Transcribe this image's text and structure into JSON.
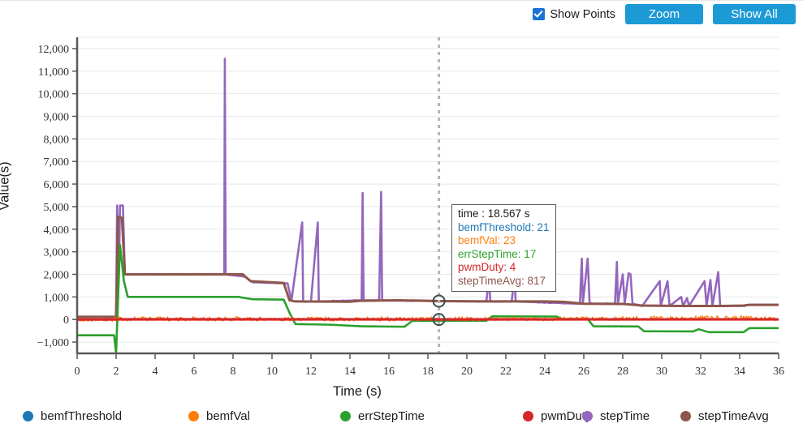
{
  "toolbar": {
    "show_points_label": "Show Points",
    "show_points_checked": true,
    "zoom_label": "Zoom",
    "show_all_label": "Show All",
    "button_color": "#1b9ad6",
    "checkbox_color": "#1a73d4"
  },
  "tooltip": {
    "time": "time : 18.567 s",
    "rows": [
      {
        "text": "bemfThreshold: 21",
        "color": "#1f77b4"
      },
      {
        "text": "bemfVal: 23",
        "color": "#ff7f0e"
      },
      {
        "text": "errStepTime: 17",
        "color": "#2ca02c"
      },
      {
        "text": "pwmDuty: 4",
        "color": "#d62728"
      },
      {
        "text": "stepTimeAvg: 817",
        "color": "#8c564b"
      }
    ]
  },
  "legend": {
    "items": [
      {
        "label": "bemfThreshold",
        "color": "#1f77b4"
      },
      {
        "label": "bemfVal",
        "color": "#ff7f0e"
      },
      {
        "label": "errStepTime",
        "color": "#2ca02c"
      },
      {
        "label": "pwmDuty",
        "color": "#d62728"
      },
      {
        "label": "stepTime",
        "color": "#9467bd"
      },
      {
        "label": "stepTimeAvg",
        "color": "#8c564b"
      }
    ]
  },
  "chart_data": {
    "type": "line",
    "title": "",
    "xlabel": "Time (s)",
    "ylabel": "Value(s)",
    "xlim": [
      0,
      36
    ],
    "ylim": [
      -1500,
      12500
    ],
    "xticks": [
      0,
      2,
      4,
      6,
      8,
      10,
      12,
      14,
      16,
      18,
      20,
      22,
      24,
      26,
      28,
      30,
      32,
      34,
      36
    ],
    "ytick_values": [
      -1000,
      0,
      1000,
      2000,
      3000,
      4000,
      5000,
      6000,
      7000,
      8000,
      9000,
      10000,
      11000,
      12000
    ],
    "ytick_labels": [
      "−1,000",
      "0",
      "1,000",
      "2,000",
      "3,000",
      "4,000",
      "5,000",
      "6,000",
      "7,000",
      "8,000",
      "9,000",
      "10,000",
      "11,000",
      "12,000"
    ],
    "grid": true,
    "legend_position": "bottom",
    "cursor": {
      "x": 18.567,
      "label": "18.567 s",
      "values": {
        "bemfThreshold": 21,
        "bemfVal": 23,
        "errStepTime": 17,
        "pwmDuty": 4,
        "stepTimeAvg": 817
      }
    },
    "series": [
      {
        "name": "bemfThreshold",
        "color": "#1f77b4",
        "points": [
          [
            0,
            21
          ],
          [
            36,
            21
          ]
        ],
        "note": "flat near 21, hidden under pwmDuty/bemfVal traces"
      },
      {
        "name": "bemfVal",
        "color": "#ff7f0e",
        "points": [
          [
            0,
            0
          ],
          [
            2.0,
            0
          ],
          [
            2.1,
            30
          ],
          [
            8.0,
            28
          ],
          [
            10.5,
            25
          ],
          [
            16.0,
            24
          ],
          [
            18.567,
            23
          ],
          [
            24.0,
            30
          ],
          [
            28.0,
            45
          ],
          [
            31.0,
            60
          ],
          [
            33.0,
            75
          ],
          [
            34.5,
            60
          ],
          [
            36,
            40
          ]
        ],
        "note": "noisy band just above zero, amplitude ~±60"
      },
      {
        "name": "errStepTime",
        "color": "#2ca02c",
        "points": [
          [
            0,
            -700
          ],
          [
            1.9,
            -700
          ],
          [
            2.0,
            -1500
          ],
          [
            2.2,
            3300
          ],
          [
            2.4,
            1700
          ],
          [
            2.6,
            1000
          ],
          [
            8.3,
            1000
          ],
          [
            8.6,
            950
          ],
          [
            9.0,
            900
          ],
          [
            10.6,
            880
          ],
          [
            10.9,
            300
          ],
          [
            11.2,
            -200
          ],
          [
            13.0,
            -230
          ],
          [
            14.6,
            -300
          ],
          [
            16.8,
            -320
          ],
          [
            17.2,
            -60
          ],
          [
            21.0,
            -55
          ],
          [
            21.3,
            140
          ],
          [
            24.6,
            130
          ],
          [
            24.9,
            30
          ],
          [
            26.2,
            20
          ],
          [
            26.5,
            -300
          ],
          [
            28.8,
            -310
          ],
          [
            29.1,
            -520
          ],
          [
            31.6,
            -530
          ],
          [
            31.9,
            -430
          ],
          [
            32.4,
            -560
          ],
          [
            34.2,
            -560
          ],
          [
            34.5,
            -380
          ],
          [
            36,
            -380
          ]
        ],
        "note": "green step trace with plateaus"
      },
      {
        "name": "pwmDuty",
        "color": "#d62728",
        "points": [
          [
            0,
            0
          ],
          [
            2.0,
            0
          ],
          [
            2.2,
            10
          ],
          [
            10.0,
            8
          ],
          [
            18.567,
            4
          ],
          [
            26.0,
            5
          ],
          [
            32.0,
            6
          ],
          [
            36,
            5
          ]
        ],
        "note": "essentially flat red line at ~0-10"
      },
      {
        "name": "stepTime",
        "color": "#9467bd",
        "points": [
          [
            0,
            0
          ],
          [
            2.0,
            0
          ],
          [
            2.05,
            5050
          ],
          [
            2.15,
            2300
          ],
          [
            2.2,
            5050
          ],
          [
            2.35,
            5050
          ],
          [
            2.45,
            2000
          ],
          [
            7.55,
            2000
          ],
          [
            7.58,
            11550
          ],
          [
            7.62,
            2000
          ],
          [
            8.6,
            1900
          ],
          [
            9.0,
            1650
          ],
          [
            10.8,
            1600
          ],
          [
            11.0,
            850
          ],
          [
            11.55,
            4300
          ],
          [
            11.6,
            800
          ],
          [
            12.0,
            800
          ],
          [
            12.35,
            4300
          ],
          [
            12.4,
            800
          ],
          [
            14.6,
            850
          ],
          [
            14.65,
            5600
          ],
          [
            14.7,
            850
          ],
          [
            15.5,
            850
          ],
          [
            15.6,
            5650
          ],
          [
            15.65,
            850
          ],
          [
            18.567,
            817
          ],
          [
            21.0,
            800
          ],
          [
            21.15,
            1900
          ],
          [
            21.2,
            800
          ],
          [
            22.3,
            800
          ],
          [
            22.45,
            1950
          ],
          [
            22.5,
            800
          ],
          [
            25.8,
            700
          ],
          [
            25.9,
            2700
          ],
          [
            25.95,
            700
          ],
          [
            26.2,
            2700
          ],
          [
            26.3,
            700
          ],
          [
            27.6,
            700
          ],
          [
            27.7,
            2550
          ],
          [
            27.75,
            700
          ],
          [
            28.0,
            2000
          ],
          [
            28.1,
            700
          ],
          [
            28.3,
            2050
          ],
          [
            28.4,
            2000
          ],
          [
            28.5,
            700
          ],
          [
            29.0,
            600
          ],
          [
            29.9,
            1700
          ],
          [
            29.95,
            600
          ],
          [
            30.3,
            1700
          ],
          [
            30.4,
            600
          ],
          [
            31.0,
            1000
          ],
          [
            31.1,
            600
          ],
          [
            31.3,
            950
          ],
          [
            31.4,
            600
          ],
          [
            32.2,
            1700
          ],
          [
            32.3,
            600
          ],
          [
            32.5,
            1750
          ],
          [
            32.6,
            600
          ],
          [
            32.9,
            2100
          ],
          [
            33.0,
            600
          ],
          [
            34.2,
            600
          ],
          [
            34.5,
            650
          ],
          [
            36,
            650
          ]
        ],
        "note": "purple trace with tall narrow spikes; max 11550 at 7.58s"
      },
      {
        "name": "stepTimeAvg",
        "color": "#8c564b",
        "points": [
          [
            0,
            120
          ],
          [
            2.0,
            120
          ],
          [
            2.1,
            4550
          ],
          [
            2.3,
            4500
          ],
          [
            2.45,
            2000
          ],
          [
            8.5,
            2000
          ],
          [
            8.9,
            1700
          ],
          [
            10.6,
            1620
          ],
          [
            10.9,
            850
          ],
          [
            11.2,
            800
          ],
          [
            14.0,
            790
          ],
          [
            14.5,
            830
          ],
          [
            16.5,
            850
          ],
          [
            18.0,
            830
          ],
          [
            18.567,
            817
          ],
          [
            21.0,
            800
          ],
          [
            24.0,
            800
          ],
          [
            25.0,
            780
          ],
          [
            26.0,
            700
          ],
          [
            28.0,
            690
          ],
          [
            29.0,
            620
          ],
          [
            31.0,
            600
          ],
          [
            33.0,
            600
          ],
          [
            34.2,
            620
          ],
          [
            34.5,
            650
          ],
          [
            36,
            650
          ]
        ],
        "note": "brown moving-average of stepTime"
      }
    ]
  }
}
